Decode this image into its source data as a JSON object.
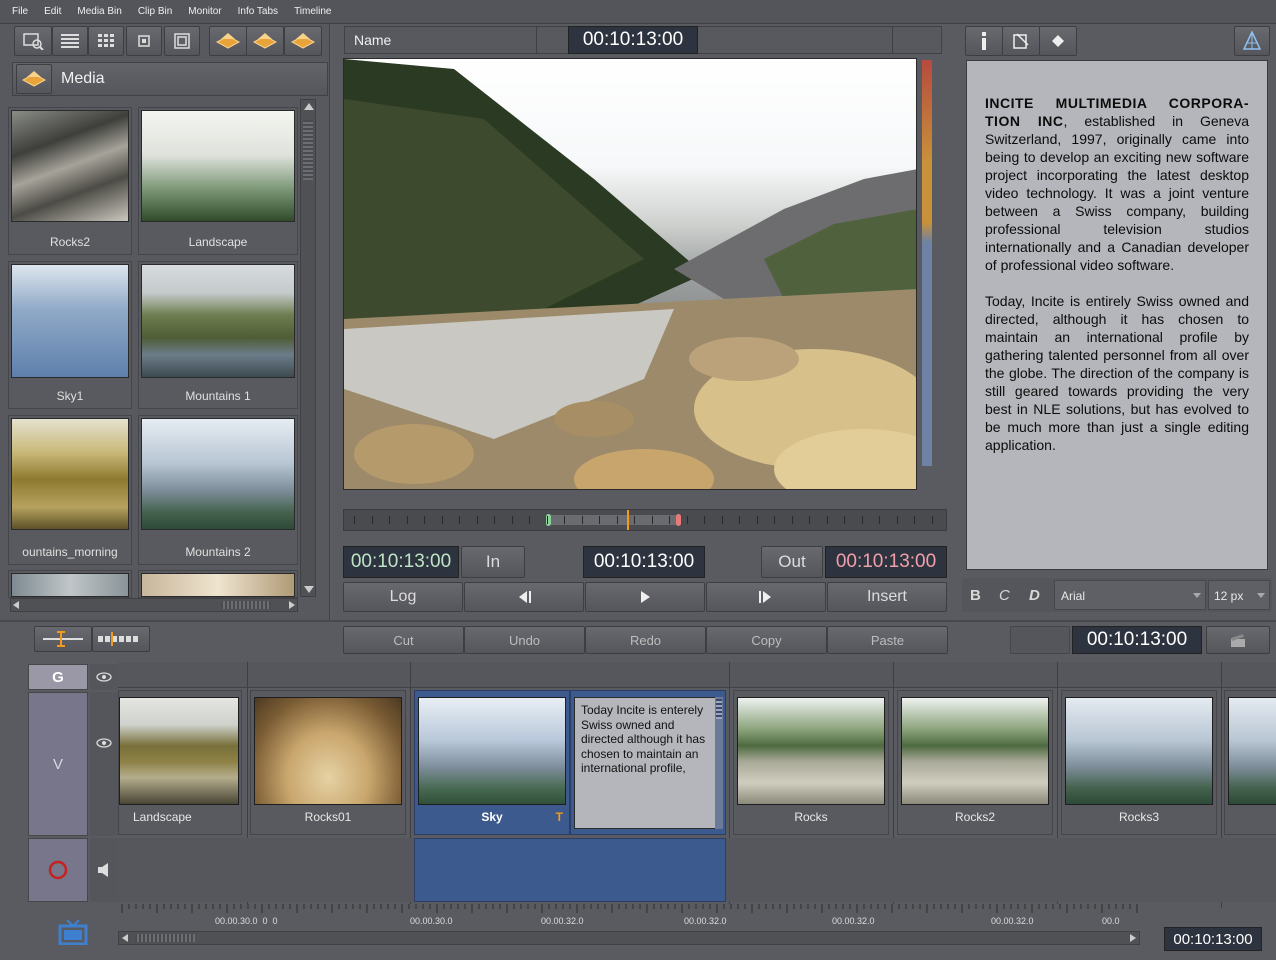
{
  "menu": [
    "File",
    "Edit",
    "Media Bin",
    "Clip Bin",
    "Monitor",
    "Info Tabs",
    "Timeline"
  ],
  "media": {
    "title": "Media",
    "items": [
      {
        "name": "Rocks2"
      },
      {
        "name": "Landscape"
      },
      {
        "name": "Sky1"
      },
      {
        "name": "Mountains 1"
      },
      {
        "name": "ountains_morning"
      },
      {
        "name": "Mountains 2"
      }
    ]
  },
  "monitor": {
    "name_label": "Name",
    "header_tc": "00:10:13:00",
    "in_tc": "00:10:13:00",
    "in_label": "In",
    "center_tc": "00:10:13:00",
    "out_label": "Out",
    "out_tc": "00:10:13:00",
    "log_label": "Log",
    "insert_label": "Insert"
  },
  "info": {
    "para1_bold": "INCITE MULTIMEDIA CORPORA-TION INC",
    "para1": ", established in Geneva Switzerland, 1997, originally came into being to develop an exciting new software project incorporating the latest desktop video technology. It was a joint venture between a Swiss company, building professional television studios internationally and a Canadian developer of professional video software.",
    "para2": "Today, Incite is entirely Swiss owned and directed, although it has chosen to maintain an international profile by gathering talented personnel from all over the globe. The direction of the company is still geared towards providing the very best in NLE solutions, but has evolved to be much more than just a single editing application.",
    "font": "Arial",
    "size": "12 px",
    "bold_label": "B",
    "c_label": "C",
    "d_label": "D"
  },
  "edit": {
    "cut": "Cut",
    "undo": "Undo",
    "redo": "Redo",
    "copy": "Copy",
    "paste": "Paste",
    "tc": "00:10:13:00"
  },
  "timeline": {
    "g_label": "G",
    "v_label": "V",
    "clips": [
      "Landscape",
      "Rocks01",
      "Sky",
      "Rocks",
      "Rocks2",
      "Rocks3"
    ],
    "sky_marker": "T",
    "text_clip": "Today Incite is enterely Swiss owned and directed although it has chosen to maintain an international profile,",
    "ruler_labels": [
      "00.00.30.0  0  0",
      "00.00.30.0",
      "00.00.32.0",
      "00.00.32.0",
      "00.00.32.0",
      "00.00.32.0",
      "00.0"
    ],
    "bottom_tc": "00:10:13:00"
  },
  "colors": {
    "accent": "#f39a1e",
    "timecode_bg": "#2e3340",
    "selected_clip": "#3d5a8e"
  }
}
